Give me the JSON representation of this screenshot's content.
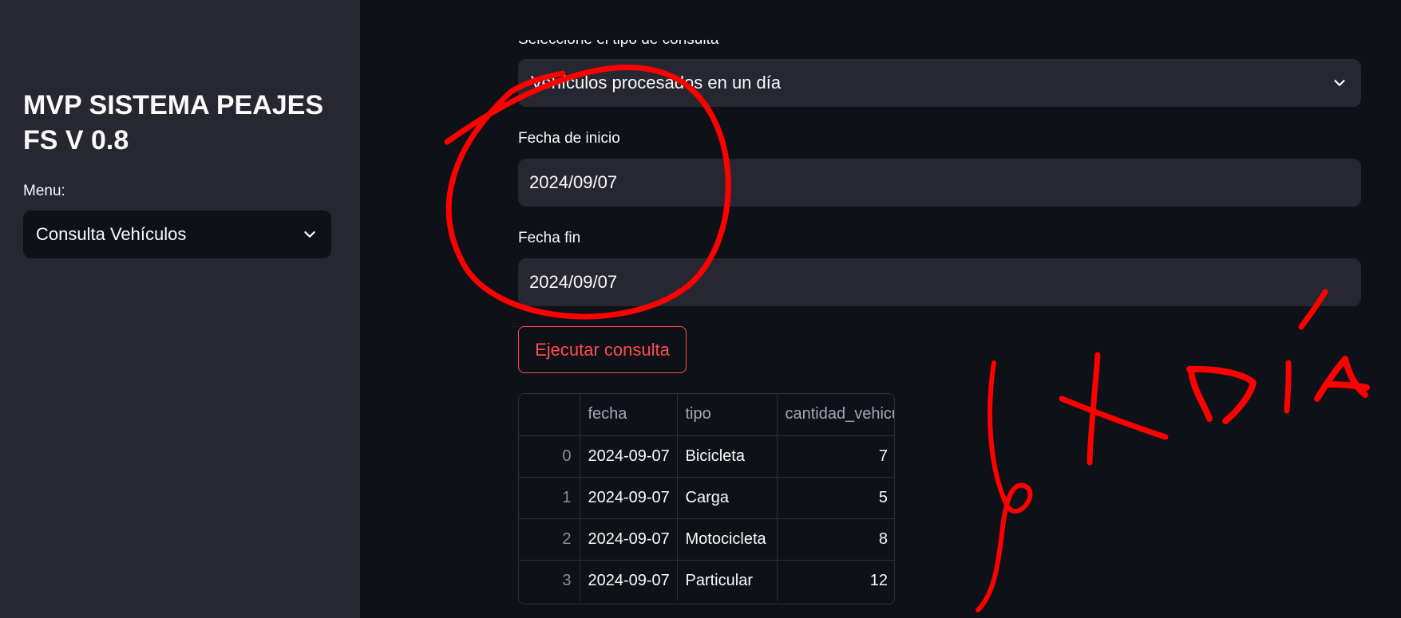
{
  "sidebar": {
    "title": "MVP SISTEMA PEAJES FS V 0.8",
    "menu_label": "Menu:",
    "menu_selected": "Consulta Vehículos"
  },
  "main": {
    "query_type_label": "Seleccione el tipo de consulta",
    "query_type_selected": "Vehículos procesados en un día",
    "start_date_label": "Fecha de inicio",
    "start_date_value": "2024/09/07",
    "end_date_label": "Fecha fin",
    "end_date_value": "2024/09/07",
    "run_button_label": "Ejecutar consulta",
    "table": {
      "columns": [
        "",
        "fecha",
        "tipo",
        "cantidad_vehiculos"
      ],
      "rows": [
        {
          "index": "0",
          "fecha": "2024-09-07",
          "tipo": "Bicicleta",
          "cantidad": "7"
        },
        {
          "index": "1",
          "fecha": "2024-09-07",
          "tipo": "Carga",
          "cantidad": "5"
        },
        {
          "index": "2",
          "fecha": "2024-09-07",
          "tipo": "Motocicleta",
          "cantidad": "8"
        },
        {
          "index": "3",
          "fecha": "2024-09-07",
          "tipo": "Particular",
          "cantidad": "12"
        }
      ]
    }
  },
  "annotation": {
    "handwritten_text": "x DÍA",
    "color": "#ff0000"
  },
  "colors": {
    "background": "#0e1117",
    "sidebar": "#262730",
    "accent": "#ff4b4b"
  }
}
